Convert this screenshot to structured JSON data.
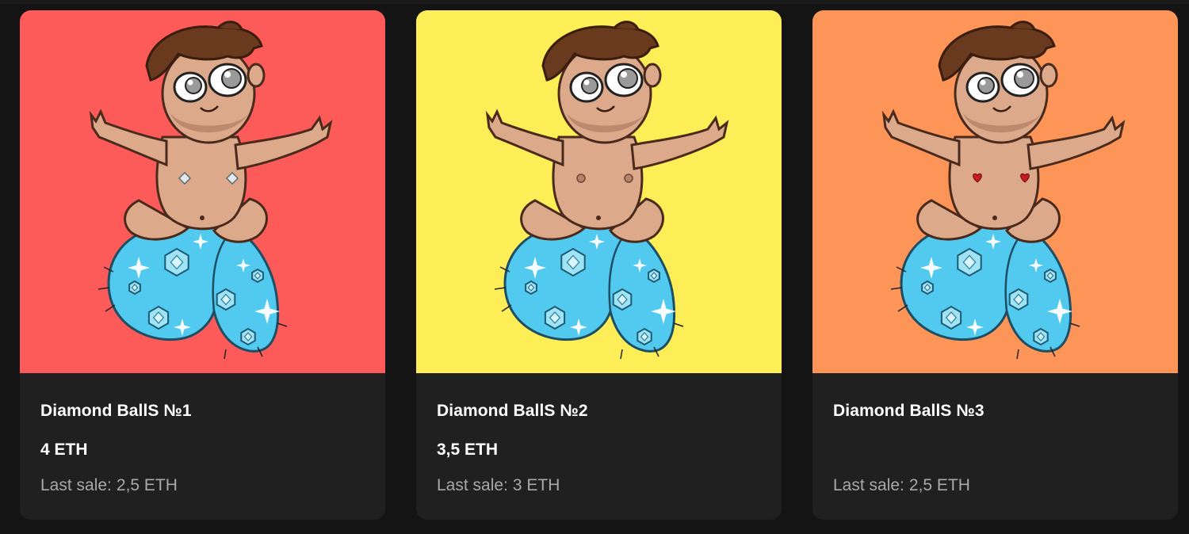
{
  "cards": [
    {
      "name": "Diamond BallS №1",
      "price": "4 ETH",
      "last_sale_label": "Last sale:",
      "last_sale_value": "2,5 ETH",
      "bg_color": "#fd5b59",
      "nipple_style": "diamond-studs"
    },
    {
      "name": "Diamond BallS №2",
      "price": "3,5 ETH",
      "last_sale_label": "Last sale:",
      "last_sale_value": "3 ETH",
      "bg_color": "#fdee58",
      "nipple_style": "plain"
    },
    {
      "name": "Diamond BallS №3",
      "price": "",
      "last_sale_label": "Last sale:",
      "last_sale_value": "2,5 ETH",
      "bg_color": "#fd9559",
      "nipple_style": "red-hearts"
    }
  ],
  "colors": {
    "page_bg": "#141414",
    "card_bg": "#202020",
    "text_primary": "#ffffff",
    "text_secondary": "#a9a9a9"
  }
}
